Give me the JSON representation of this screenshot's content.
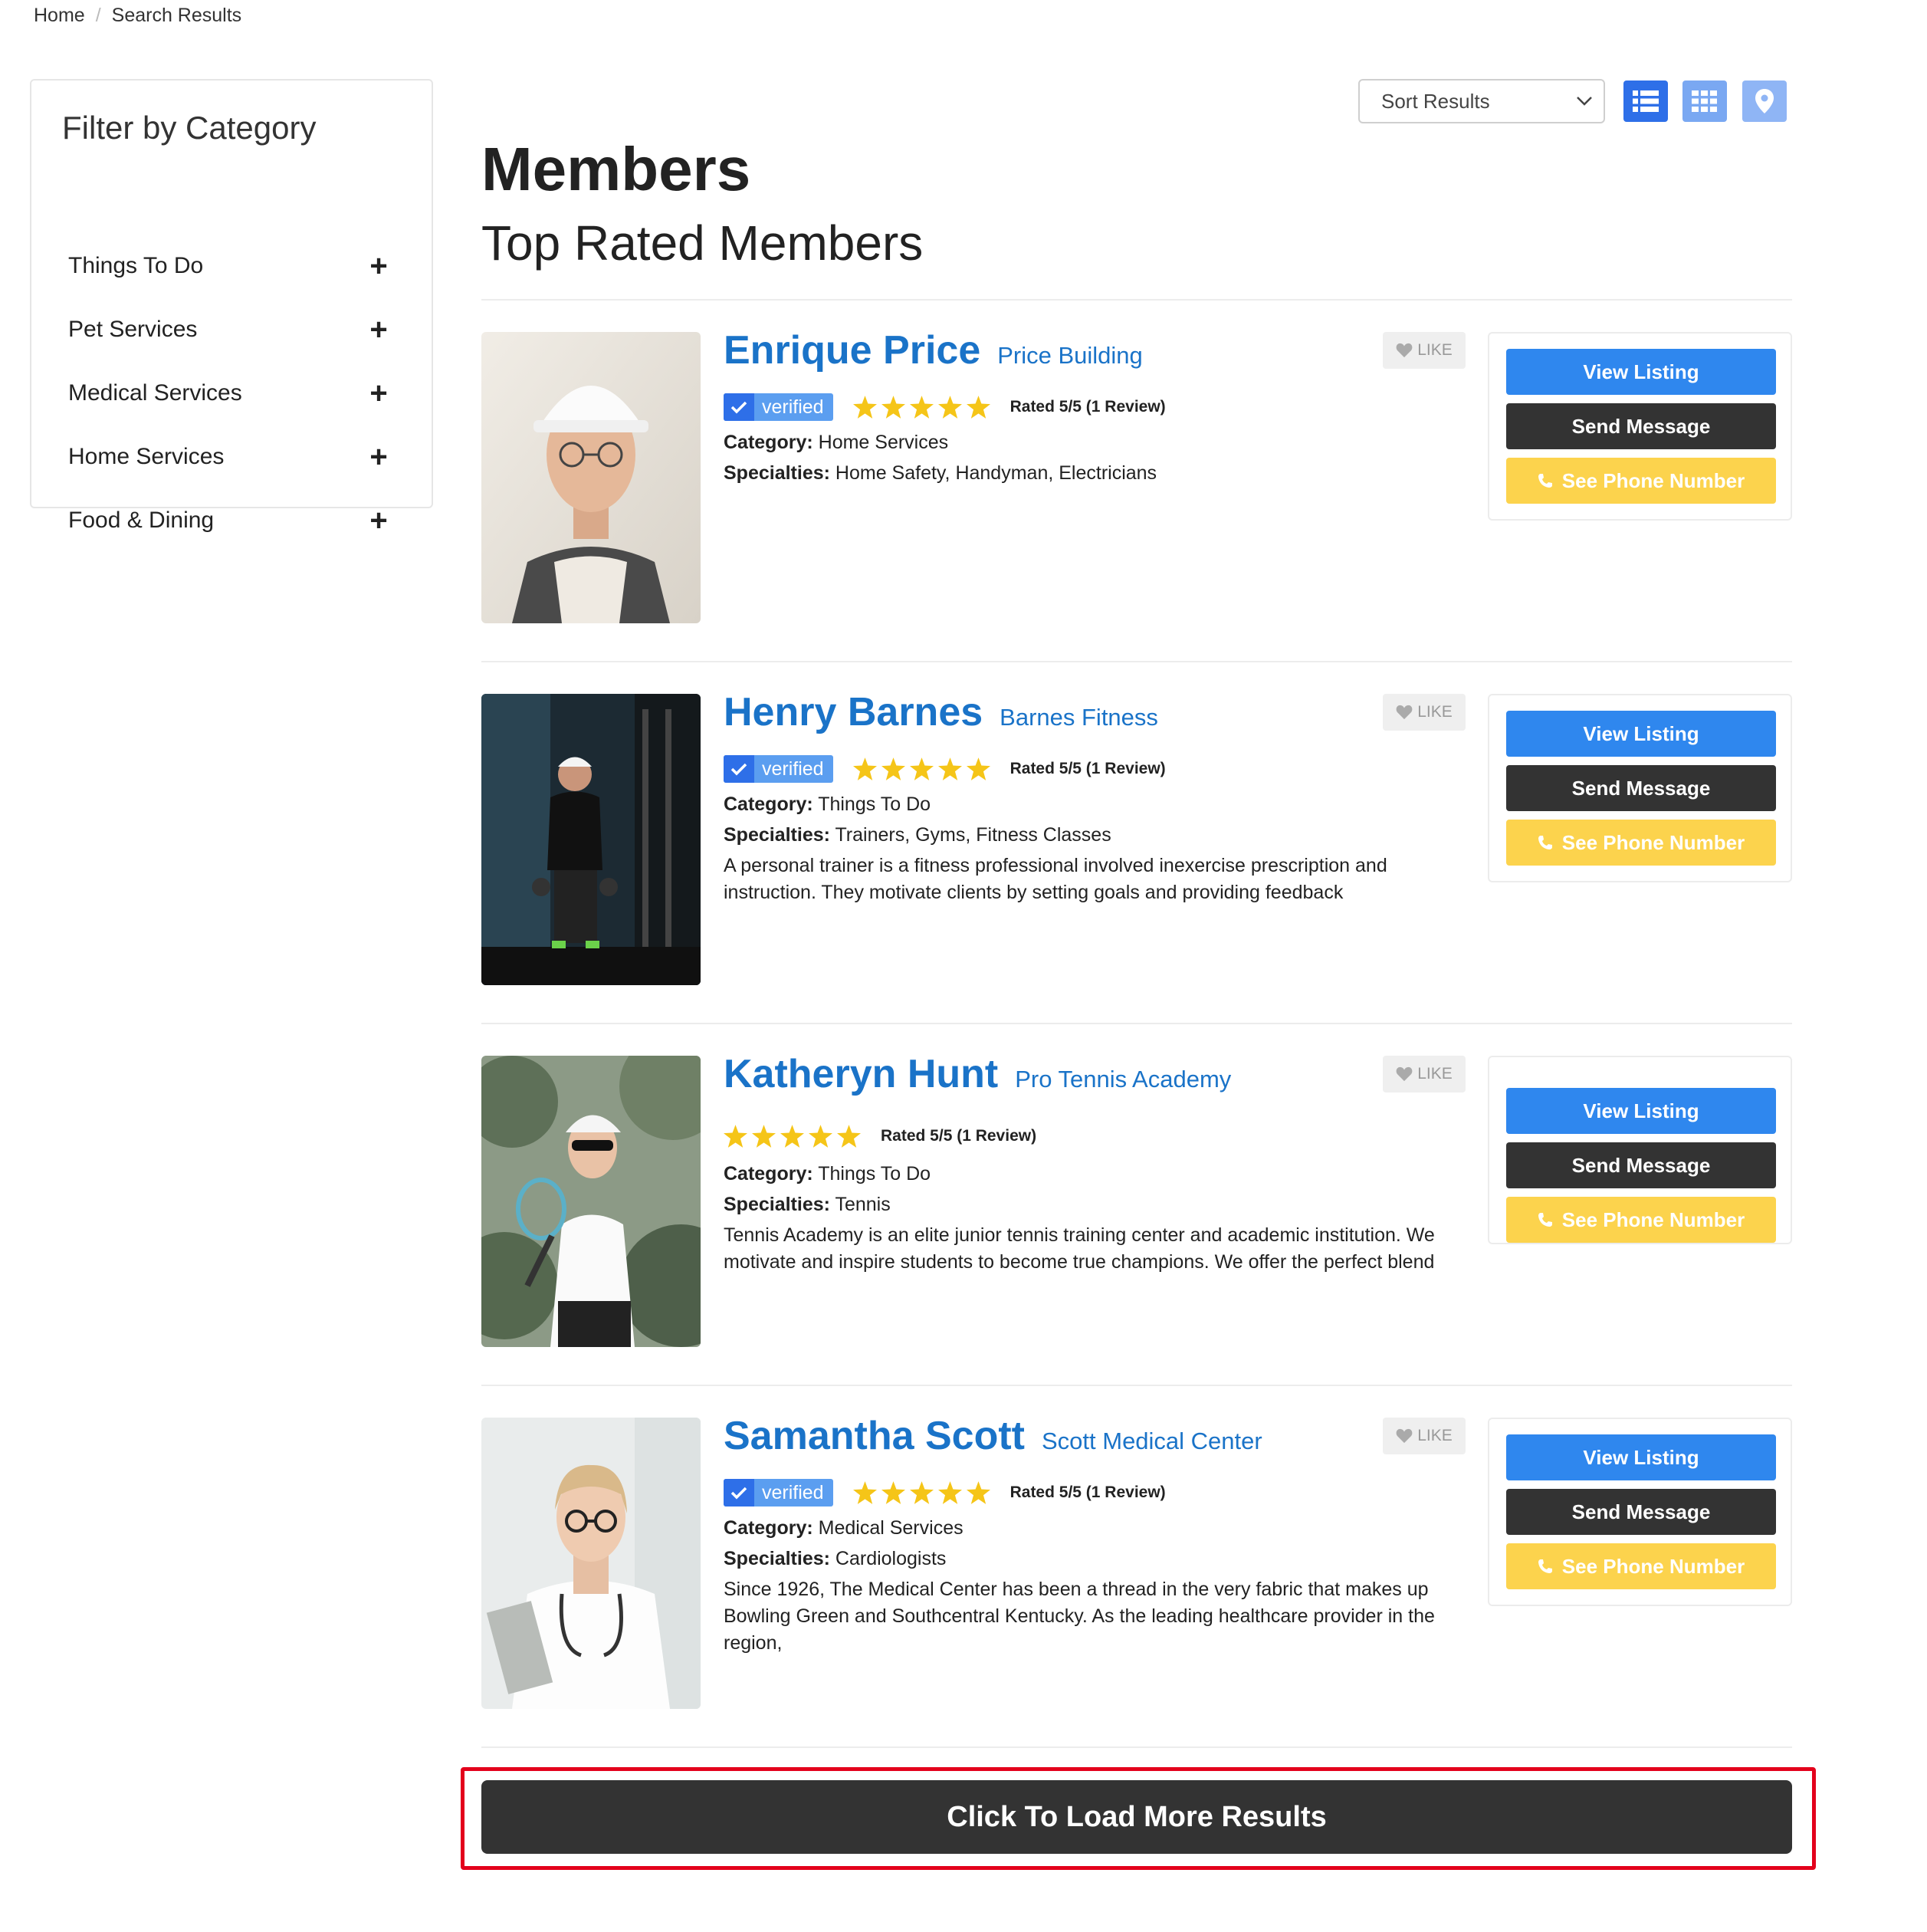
{
  "breadcrumb": {
    "home": "Home",
    "separator": "/",
    "current": "Search Results"
  },
  "sidebar": {
    "title": "Filter by Category",
    "items": [
      {
        "label": "Things To Do"
      },
      {
        "label": "Pet Services"
      },
      {
        "label": "Medical Services"
      },
      {
        "label": "Home Services"
      },
      {
        "label": "Food & Dining"
      }
    ]
  },
  "toolbar": {
    "sort_label": "Sort Results",
    "view_icons": [
      "list-view-icon",
      "grid-view-icon",
      "map-pin-icon"
    ]
  },
  "header": {
    "title": "Members",
    "subtitle": "Top Rated Members"
  },
  "labels": {
    "verified": "verified",
    "like": "LIKE",
    "category": "Category:",
    "specialties": "Specialties:",
    "view_listing": "View Listing",
    "send_message": "Send Message",
    "see_phone": "See Phone Number"
  },
  "members": [
    {
      "name": "Enrique Price",
      "company": "Price Building",
      "verified": true,
      "stars": 5,
      "rated": "Rated 5/5 (1 Review)",
      "category": "Home Services",
      "specialties": "Home Safety, Handyman, Electricians",
      "description": ""
    },
    {
      "name": "Henry Barnes",
      "company": "Barnes Fitness",
      "verified": true,
      "stars": 5,
      "rated": "Rated 5/5 (1 Review)",
      "category": "Things To Do",
      "specialties": "Trainers, Gyms, Fitness Classes",
      "description": "A personal trainer is a fitness professional involved inexercise prescription and instruction. They motivate clients by setting goals and providing feedback"
    },
    {
      "name": "Katheryn Hunt",
      "company": "Pro Tennis Academy",
      "verified": false,
      "stars": 5,
      "rated": "Rated 5/5 (1 Review)",
      "category": "Things To Do",
      "specialties": "Tennis",
      "description": "Tennis Academy is an elite junior tennis training center and academic institution. We motivate and inspire students to become true champions. We offer the perfect blend"
    },
    {
      "name": "Samantha Scott",
      "company": "Scott Medical Center",
      "verified": true,
      "stars": 5,
      "rated": "Rated 5/5 (1 Review)",
      "category": "Medical Services",
      "specialties": "Cardiologists",
      "description": "Since 1926, The Medical Center has been a thread in the very fabric that makes up Bowling Green and Southcentral Kentucky. As the leading healthcare provider in the region,"
    }
  ],
  "load_more": {
    "label": "Click To Load More Results"
  },
  "colors": {
    "accent_blue": "#1a73c8",
    "button_blue": "#2f87ee",
    "button_dark": "#333333",
    "button_yellow": "#fcd34d",
    "star_yellow": "#f5c518",
    "highlight_red": "#e3001b"
  }
}
